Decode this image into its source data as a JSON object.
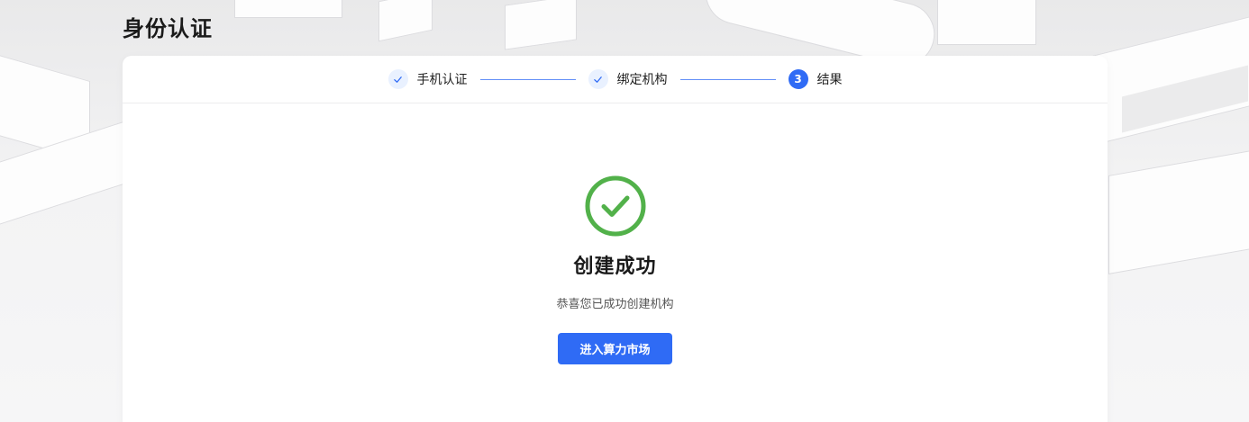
{
  "page": {
    "title": "身份认证"
  },
  "steps": [
    {
      "label": "手机认证",
      "status": "done",
      "icon": "check-icon"
    },
    {
      "label": "绑定机构",
      "status": "done",
      "icon": "check-icon"
    },
    {
      "label": "结果",
      "status": "active",
      "number": "3"
    }
  ],
  "result": {
    "icon": "success-check-circle-icon",
    "title": "创建成功",
    "description": "恭喜您已成功创建机构",
    "button_label": "进入算力市场"
  },
  "colors": {
    "primary": "#2f6bf5",
    "success": "#52b14a",
    "step_done_bg": "#e9f1ff"
  }
}
